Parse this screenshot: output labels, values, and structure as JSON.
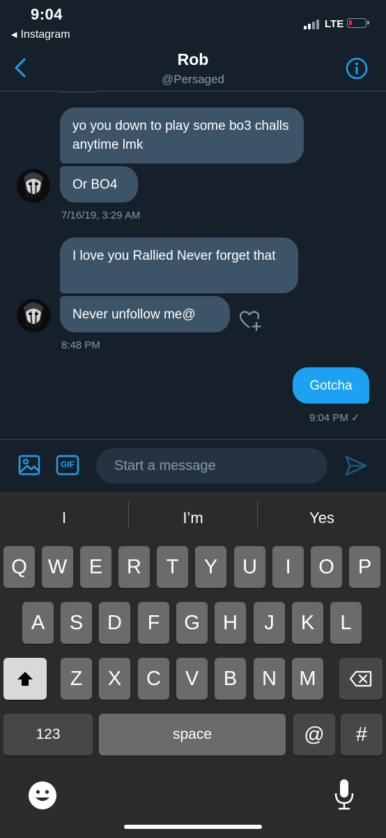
{
  "status": {
    "time": "9:04",
    "back_app": "Instagram",
    "network": "LTE",
    "battery_color": "#e0245e"
  },
  "header": {
    "title": "Rob",
    "handle": "@Persaged",
    "back_icon": "chevron-left-icon",
    "info_icon": "info-icon",
    "accent": "#1da1f2"
  },
  "messages": {
    "group1": {
      "msg1": "yo you down to play some bo3 challs anytime lmk",
      "msg2": "Or BO4",
      "timestamp": "7/16/19, 3:29 AM"
    },
    "group2": {
      "msg1": "I love you Rallied Never forget that",
      "msg2": "Never unfollow me@",
      "timestamp": "8:48 PM"
    },
    "outgoing": {
      "msg1": "Gotcha",
      "timestamp": "9:04 PM ✓"
    }
  },
  "composer": {
    "placeholder": "Start a message",
    "gif_label": "GIF",
    "image_icon": "image-icon",
    "send_icon": "send-icon"
  },
  "keyboard": {
    "predictions": [
      "I",
      "I’m",
      "Yes"
    ],
    "row1": [
      "Q",
      "W",
      "E",
      "R",
      "T",
      "Y",
      "U",
      "I",
      "O",
      "P"
    ],
    "row2": [
      "A",
      "S",
      "D",
      "F",
      "G",
      "H",
      "J",
      "K",
      "L"
    ],
    "row3": [
      "Z",
      "X",
      "C",
      "V",
      "B",
      "N",
      "M"
    ],
    "numbers_key": "123",
    "space_key": "space",
    "at_key": "@",
    "hash_key": "#"
  }
}
